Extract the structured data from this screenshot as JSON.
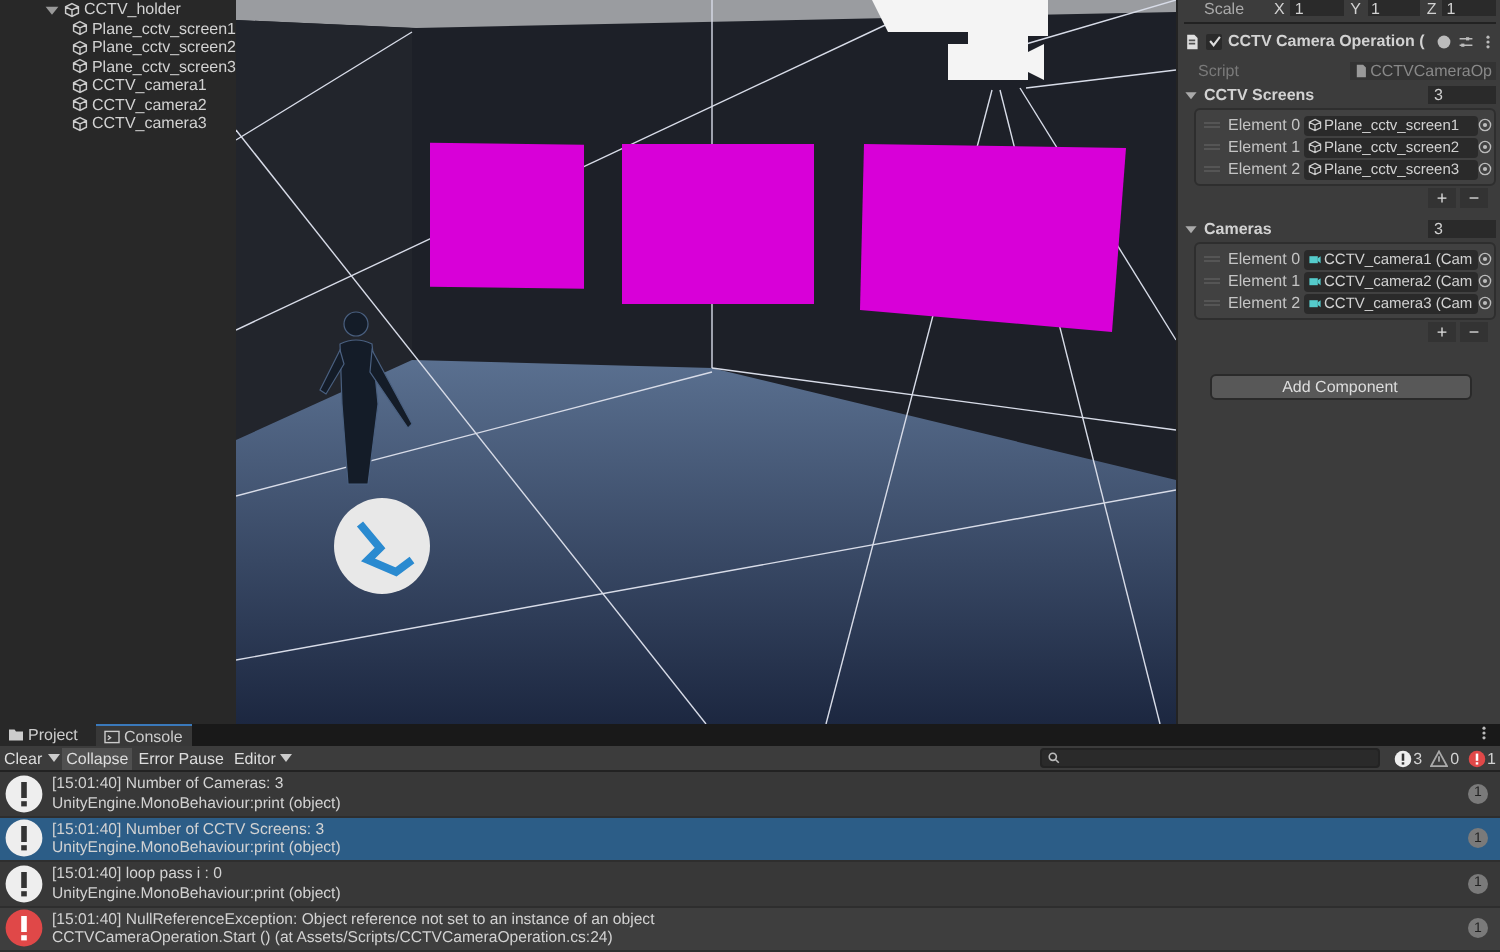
{
  "hierarchy": {
    "items": [
      {
        "label": "CCTV_holder",
        "expanded": true,
        "children": [
          {
            "label": "Plane_cctv_screen1"
          },
          {
            "label": "Plane_cctv_screen2"
          },
          {
            "label": "Plane_cctv_screen3"
          },
          {
            "label": "CCTV_camera1"
          },
          {
            "label": "CCTV_camera2"
          },
          {
            "label": "CCTV_camera3"
          }
        ]
      }
    ]
  },
  "inspector": {
    "scale": {
      "label": "Scale",
      "axes": [
        {
          "axis": "X",
          "value": "1"
        },
        {
          "axis": "Y",
          "value": "1"
        },
        {
          "axis": "Z",
          "value": "1"
        }
      ]
    },
    "component": {
      "title": "CCTV Camera Operation (",
      "enabled": true,
      "script_label": "Script",
      "script_value": "CCTVCameraOp"
    },
    "lists": [
      {
        "title": "CCTV Screens",
        "count": "3",
        "expanded": true,
        "elements": [
          {
            "label": "Element 0",
            "value": "Plane_cctv_screen1",
            "kind": "object"
          },
          {
            "label": "Element 1",
            "value": "Plane_cctv_screen2",
            "kind": "object"
          },
          {
            "label": "Element 2",
            "value": "Plane_cctv_screen3",
            "kind": "object"
          }
        ],
        "add": "+",
        "remove": "−"
      },
      {
        "title": "Cameras",
        "count": "3",
        "expanded": true,
        "elements": [
          {
            "label": "Element 0",
            "value": "CCTV_camera1 (Cam",
            "kind": "camera"
          },
          {
            "label": "Element 1",
            "value": "CCTV_camera2 (Cam",
            "kind": "camera"
          },
          {
            "label": "Element 2",
            "value": "CCTV_camera3 (Cam",
            "kind": "camera"
          }
        ],
        "add": "+",
        "remove": "−"
      }
    ],
    "add_button": "Add Component"
  },
  "console": {
    "tabs": [
      {
        "label": "Project",
        "selected": false
      },
      {
        "label": "Console",
        "selected": true
      }
    ],
    "toolbar": [
      {
        "label": "Clear",
        "kind": "split",
        "on": false
      },
      {
        "label": "Collapse",
        "kind": "toggle",
        "on": true
      },
      {
        "label": "Error Pause",
        "kind": "toggle",
        "on": false
      },
      {
        "label": "Editor",
        "kind": "dropdown",
        "on": false
      }
    ],
    "counts": [
      {
        "kind": "info",
        "value": "3"
      },
      {
        "kind": "warning",
        "value": "0"
      },
      {
        "kind": "error",
        "value": "1"
      }
    ],
    "entries": [
      {
        "kind": "info",
        "selected": false,
        "line1": "[15:01:40] Number of Cameras: 3",
        "line2": "UnityEngine.MonoBehaviour:print (object)",
        "count": "1"
      },
      {
        "kind": "info",
        "selected": true,
        "line1": "[15:01:40] Number of CCTV Screens: 3",
        "line2": "UnityEngine.MonoBehaviour:print (object)",
        "count": "1"
      },
      {
        "kind": "info",
        "selected": false,
        "line1": "[15:01:40] loop pass i : 0",
        "line2": "UnityEngine.MonoBehaviour:print (object)",
        "count": "1"
      },
      {
        "kind": "error",
        "selected": false,
        "line1": "[15:01:40] NullReferenceException: Object reference not set to an instance of an object",
        "line2": "CCTVCameraOperation.Start () (at Assets/Scripts/CCTVCameraOperation.cs:24)",
        "count": "1"
      }
    ]
  }
}
